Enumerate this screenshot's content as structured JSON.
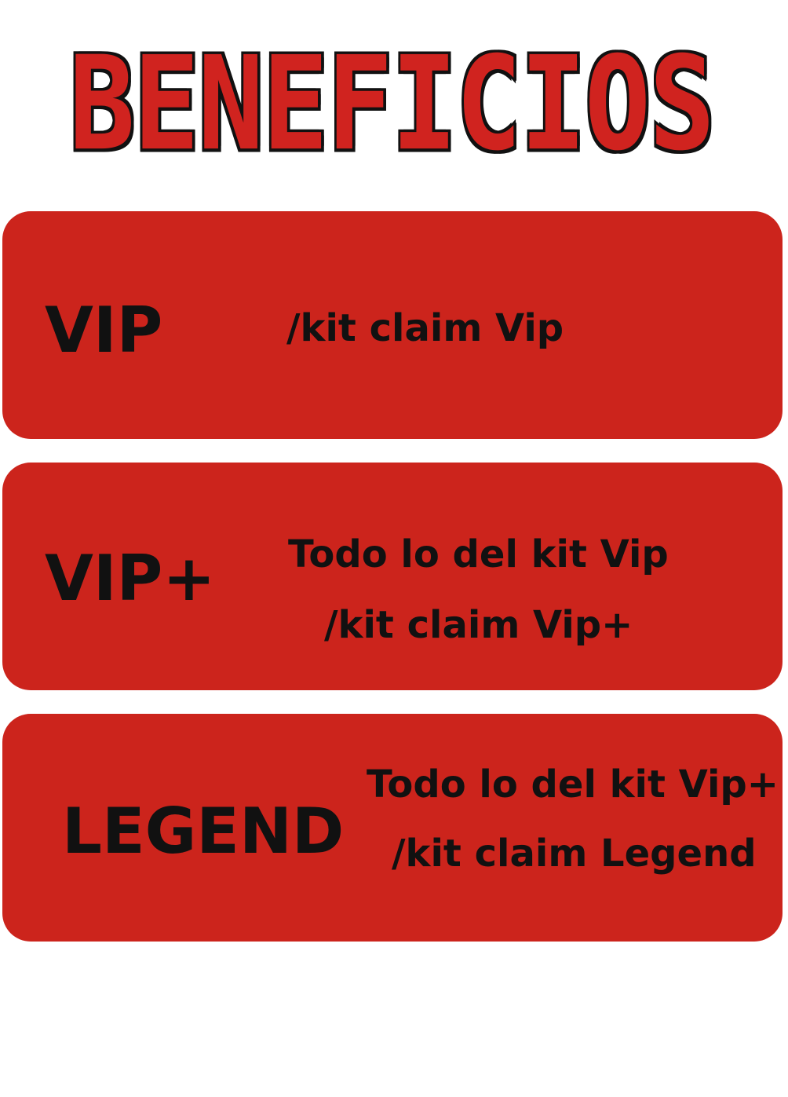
{
  "header": {
    "title": "BENEFICIOS"
  },
  "colors": {
    "card_background": "#cc241c",
    "title_fill": "#d0231f",
    "title_outline": "#111111",
    "text": "#111111",
    "page_background": "#ffffff"
  },
  "tiers": [
    {
      "name": "VIP",
      "lines": [
        "/kit claim Vip"
      ]
    },
    {
      "name": "VIP+",
      "lines": [
        "Todo lo del kit Vip",
        "/kit claim Vip+"
      ]
    },
    {
      "name": "LEGEND",
      "lines": [
        "Todo lo del kit Vip+",
        "/kit claim Legend"
      ]
    }
  ]
}
